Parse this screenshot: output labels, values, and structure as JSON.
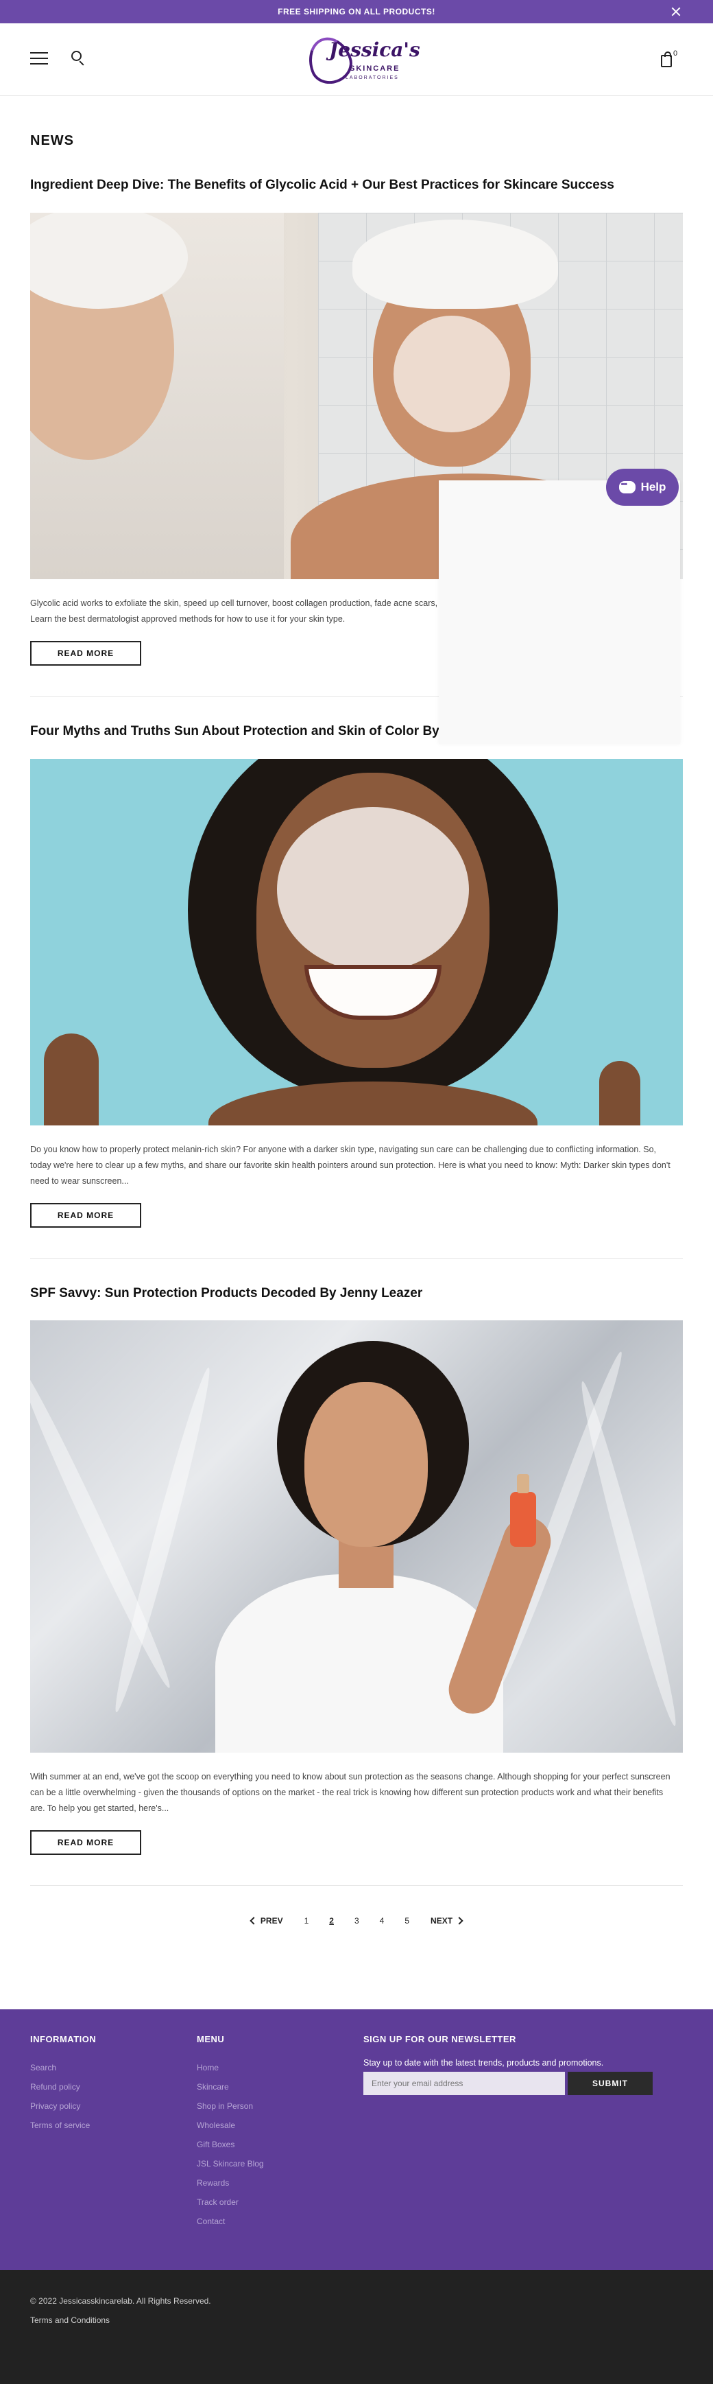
{
  "announcement": {
    "text": "FREE SHIPPING ON ALL PRODUCTS!"
  },
  "header": {
    "logo_script": "Jessica's",
    "logo_line1": "SKINCARE",
    "logo_line2": "LABORATORIES",
    "cart_count": "0"
  },
  "page": {
    "title": "NEWS"
  },
  "articles": [
    {
      "title": "Ingredient Deep Dive: The Benefits of Glycolic Acid + Our Best Practices for Skincare Success",
      "excerpt": "Glycolic acid works to exfoliate the skin, speed up cell turnover, boost collagen production, fade acne scars, smooth fine lines, and reveal your healthiest brightest skin. Learn the best dermatologist approved methods for how to use it for your skin type.",
      "button": "READ MORE"
    },
    {
      "title": "Four Myths and Truths Sun About Protection and Skin of Color By Jenny Leazer",
      "excerpt": "Do you know how to properly protect melanin-rich skin?   For anyone with a darker skin type, navigating sun care can be challenging due to conflicting information. So, today we're here to clear up a few myths, and share our favorite skin health pointers around sun protection. Here is what you need to know: Myth: Darker skin types don't need to wear sunscreen...",
      "button": "READ MORE"
    },
    {
      "title": "SPF Savvy: Sun Protection Products Decoded By Jenny Leazer",
      "excerpt": "With summer at an end, we've got the scoop on everything you need to know about sun protection as the seasons change.  Although shopping for your perfect sunscreen can be a little overwhelming - given the thousands of options on the market - the real trick is knowing how different sun protection products work and what their benefits are. To help you get started, here's...",
      "button": "READ MORE"
    }
  ],
  "help": {
    "label": "Help"
  },
  "pagination": {
    "prev": "PREV",
    "next": "NEXT",
    "pages": [
      "1",
      "2",
      "3",
      "4",
      "5"
    ],
    "current": "2"
  },
  "footer": {
    "information": {
      "heading": "INFORMATION",
      "links": [
        "Search",
        "Refund policy",
        "Privacy policy",
        "Terms of service"
      ]
    },
    "menu": {
      "heading": "MENU",
      "links": [
        "Home",
        "Skincare",
        "Shop in Person",
        "Wholesale",
        "Gift Boxes",
        "JSL Skincare Blog",
        "Rewards",
        "Track order",
        "Contact"
      ]
    },
    "newsletter": {
      "heading": "SIGN UP FOR OUR NEWSLETTER",
      "text": "Stay up to date with the latest trends, products and promotions.",
      "placeholder": "Enter your email address",
      "button": "SUBMIT"
    }
  },
  "bottom": {
    "copyright": "© 2022 Jessicasskincarelab. All Rights Reserved.",
    "terms": "Terms and Conditions"
  },
  "colors": {
    "brand_purple": "#6b4aa8",
    "footer_purple": "#5e3d98",
    "bottom_dark": "#222222"
  }
}
